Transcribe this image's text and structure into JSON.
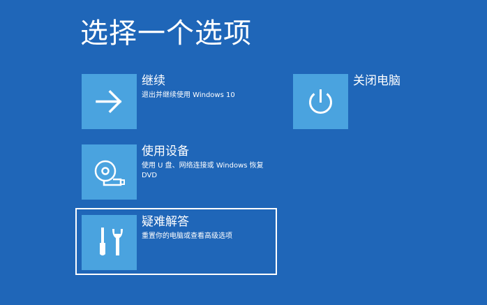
{
  "page": {
    "title": "选择一个选项"
  },
  "options": {
    "continue": {
      "title": "继续",
      "description": "退出并继续使用 Windows 10",
      "icon": "arrow-right-icon"
    },
    "use_device": {
      "title": "使用设备",
      "description": "使用 U 盘、网络连接或 Windows 恢复 DVD",
      "icon": "disc-drive-icon"
    },
    "troubleshoot": {
      "title": "疑难解答",
      "description": "重置你的电脑或查看高级选项",
      "icon": "tools-icon",
      "focused": true
    },
    "shutdown": {
      "title": "关闭电脑",
      "icon": "power-icon"
    }
  },
  "colors": {
    "background": "#1f66b8",
    "tile": "#4aa3df",
    "text": "#ffffff",
    "focus_border": "#ffffff"
  }
}
